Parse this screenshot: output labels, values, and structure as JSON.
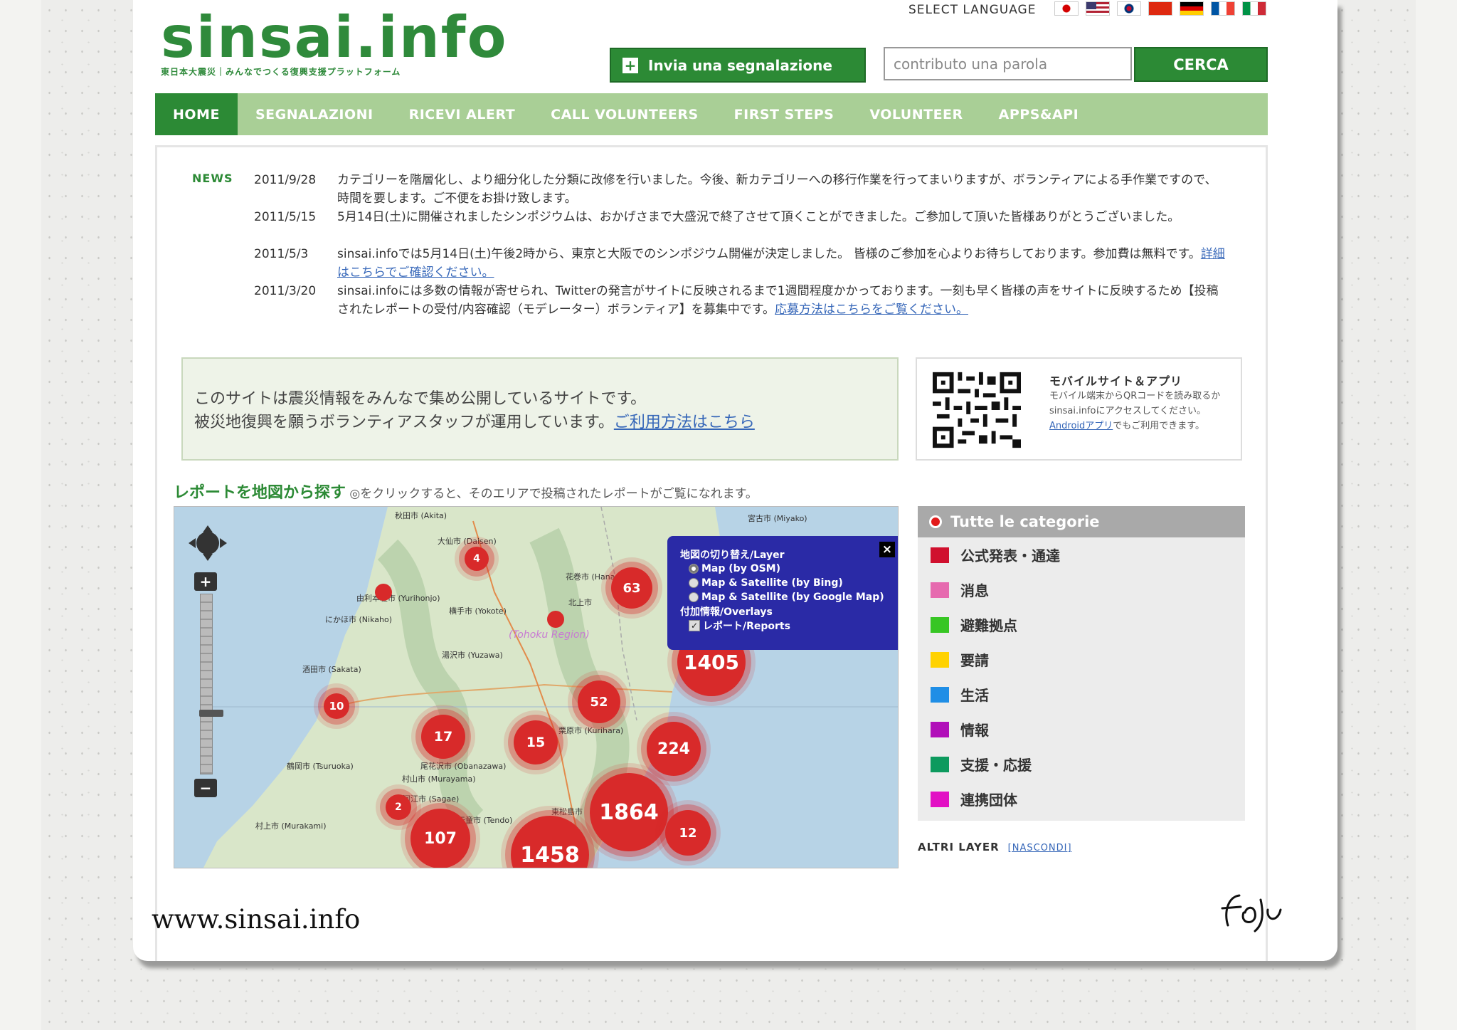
{
  "header": {
    "logo": "sinsai.info",
    "logo_subtitle": "東日本大震災｜みんなでつくる復興支援プラットフォーム",
    "select_language": "SELECT LANGUAGE",
    "flags": [
      "jp-flag-icon",
      "us-flag-icon",
      "kr-flag-icon",
      "cn-flag-icon",
      "de-flag-icon",
      "fr-flag-icon",
      "it-flag-icon"
    ],
    "report_button": "Invia una segnalazione",
    "search_placeholder": "contributo una parola",
    "search_button": "CERCA"
  },
  "nav": {
    "items": [
      "HOME",
      "SEGNALAZIONI",
      "RICEVI ALERT",
      "CALL VOLUNTEERS",
      "FIRST STEPS",
      "VOLUNTEER",
      "APPS&API"
    ]
  },
  "news": {
    "label": "NEWS",
    "items": [
      {
        "date": "2011/9/28",
        "text": "カテゴリーを階層化し、より細分化した分類に改修を行いました。今後、新カテゴリーへの移行作業を行ってまいりますが、ボランティアによる手作業ですので、時間を要します。ご不便をお掛け致します。",
        "link": ""
      },
      {
        "date": "2011/5/15",
        "text": "5月14日(土)に開催されましたシンポジウムは、おかげさまで大盛況で終了させて頂くことができました。ご参加して頂いた皆様ありがとうございました。",
        "link": ""
      },
      {
        "date": "2011/5/3",
        "text": "sinsai.infoでは5月14日(土)午後2時から、東京と大阪でのシンポジウム開催が決定しました。 皆様のご参加を心よりお待ちしております。参加費は無料です。",
        "link": "詳細はこちらでご確認ください。"
      },
      {
        "date": "2011/3/20",
        "text": "sinsai.infoには多数の情報が寄せられ、Twitterの発言がサイトに反映されるまで1週間程度かかっております。一刻も早く皆様の声をサイトに反映するため【投稿されたレポートの受付/内容確認（モデレーター）ボランティア】を募集中です。",
        "link": "応募方法はこちらをご覧ください。"
      }
    ]
  },
  "info": {
    "line1": "このサイトは震災情報をみんなで集め公開しているサイトです。",
    "line2": "被災地復興を願うボランティアスタッフが運用しています。",
    "link": "ご利用方法はこちら"
  },
  "mobile": {
    "title": "モバイルサイト＆アプリ",
    "text": "モバイル端末からQRコードを読み取るか sinsai.infoにアクセスしてください。",
    "link": "Androidアプリ",
    "text_after": "でもご利用できます。"
  },
  "map": {
    "heading": "レポートを地図から探す",
    "heading_note": "◎をクリックすると、そのエリアで投稿されたレポートがご覧になれます。",
    "region_label": "(Tohoku Region)",
    "towns": [
      "秋田市 (Akita)",
      "大仙市 (Daisen)",
      "由利本荘市 (Yurihonjo)",
      "にかほ市 (Nikaho)",
      "横手市 (Yokote)",
      "湯沢市 (Yuzawa)",
      "酒田市 (Sakata)",
      "鶴岡市 (Tsuruoka)",
      "村上市 (Murakami)",
      "花巻市 (Hanamaki)",
      "北上市",
      "宮古市 (Miyako)",
      "尾花沢市 (Obanazawa)",
      "村山市 (Murayama)",
      "寒河江市 (Sagae)",
      "天童市 (Tendo)",
      "東松島市",
      "栗原市 (Kurihara)"
    ],
    "clusters": [
      "4",
      "63",
      "1405",
      "52",
      "10",
      "17",
      "15",
      "224",
      "1864",
      "2",
      "107",
      "1458",
      "12"
    ],
    "layer_panel": {
      "title": "地図の切り替え/Layer",
      "options": [
        "Map (by OSM)",
        "Map & Satellite (by Bing)",
        "Map & Satellite (by Google Map)"
      ],
      "overlays_title": "付加情報/Overlays",
      "overlay": "レポート/Reports",
      "close": "×"
    },
    "zoom_in": "+",
    "zoom_out": "−"
  },
  "categories": {
    "head": "Tutte le categorie",
    "items": [
      {
        "label": "公式発表・通達",
        "color": "#d0102e"
      },
      {
        "label": "消息",
        "color": "#e66aaf"
      },
      {
        "label": "避難拠点",
        "color": "#37c624"
      },
      {
        "label": "要請",
        "color": "#ffd200"
      },
      {
        "label": "生活",
        "color": "#1f8ee6"
      },
      {
        "label": "情報",
        "color": "#b10eb9"
      },
      {
        "label": "支援・応援",
        "color": "#0d9a5e"
      },
      {
        "label": "連携団体",
        "color": "#e210c4"
      }
    ],
    "altri": "ALTRI LAYER",
    "nascondi": "[NASCONDI]"
  },
  "footer": {
    "url": "www.sinsai.info",
    "signature": "foju"
  }
}
